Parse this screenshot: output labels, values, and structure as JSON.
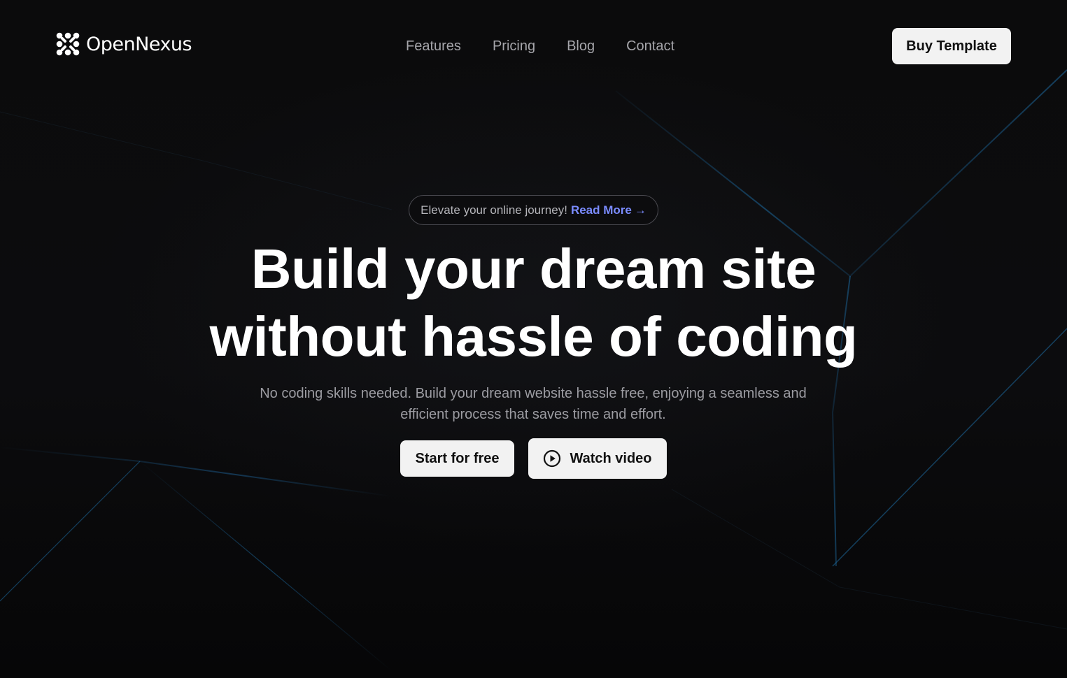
{
  "brand": {
    "name": "OpenNexus",
    "logo_icon": "nexus-dots-icon"
  },
  "nav": {
    "links": [
      "Features",
      "Pricing",
      "Blog",
      "Contact"
    ],
    "cta_label": "Buy Template"
  },
  "hero": {
    "announcement_text": "Elevate your online journey!",
    "announcement_link": "Read More",
    "announcement_arrow": "→",
    "headline_line1": "Build your dream site",
    "headline_line2": "without hassle of coding",
    "subtext_line1": "No coding skills needed. Build your dream website hassle free, enjoying a seamless and",
    "subtext_line2": "efficient process that saves time and effort.",
    "primary_button": "Start for free",
    "secondary_button": "Watch video",
    "secondary_icon": "play-circle-icon"
  },
  "colors": {
    "background": "#0a0a0b",
    "accent_link": "#7b8cff",
    "button_bg": "#f2f2f2",
    "nav_text": "#a6a6ab",
    "glow_lines": "#1c5a8a"
  }
}
